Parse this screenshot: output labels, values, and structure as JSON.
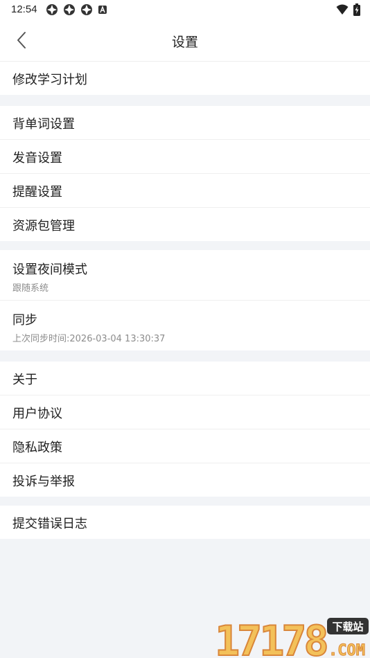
{
  "status_bar": {
    "time": "12:54",
    "left_icons": [
      "app-notification-icon",
      "app-notification-icon",
      "app-notification-icon",
      "a-badge-icon"
    ],
    "right_icons": [
      "wifi-icon",
      "battery-charging-icon"
    ]
  },
  "header": {
    "title": "设置",
    "back_icon": "chevron-left-icon"
  },
  "sections": [
    {
      "items": [
        {
          "label": "修改学习计划"
        }
      ]
    },
    {
      "items": [
        {
          "label": "背单词设置"
        },
        {
          "label": "发音设置"
        },
        {
          "label": "提醒设置"
        },
        {
          "label": "资源包管理"
        }
      ]
    },
    {
      "items": [
        {
          "label": "设置夜间模式",
          "subtitle": "跟随系统"
        },
        {
          "label": "同步",
          "subtitle": "上次同步时间:2026-03-04 13:30:37"
        }
      ]
    },
    {
      "items": [
        {
          "label": "关于"
        },
        {
          "label": "用户协议"
        },
        {
          "label": "隐私政策"
        },
        {
          "label": "投诉与举报"
        }
      ]
    },
    {
      "items": [
        {
          "label": "提交错误日志"
        }
      ]
    }
  ],
  "watermark": {
    "text": "17178",
    "badge": "下载站",
    "suffix": ".COM"
  },
  "colors": {
    "background": "#f2f4f7",
    "surface": "#ffffff",
    "text": "#1f1f1f",
    "subtext": "#8c8c8c"
  }
}
